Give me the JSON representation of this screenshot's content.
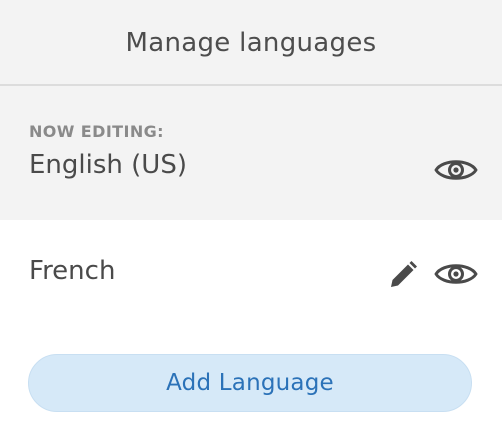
{
  "header": {
    "title": "Manage languages"
  },
  "current": {
    "caption": "NOW EDITING:",
    "language": "English (US)",
    "preview_icon": "eye-icon"
  },
  "languages": [
    {
      "name": "French",
      "edit_icon": "pencil-icon",
      "preview_icon": "eye-icon"
    }
  ],
  "actions": {
    "add_label": "Add Language"
  },
  "colors": {
    "header_bg": "#f3f3f3",
    "accent": "#2b72b8",
    "button_bg": "#d6e9f8",
    "icon": "#4a4a4a"
  }
}
